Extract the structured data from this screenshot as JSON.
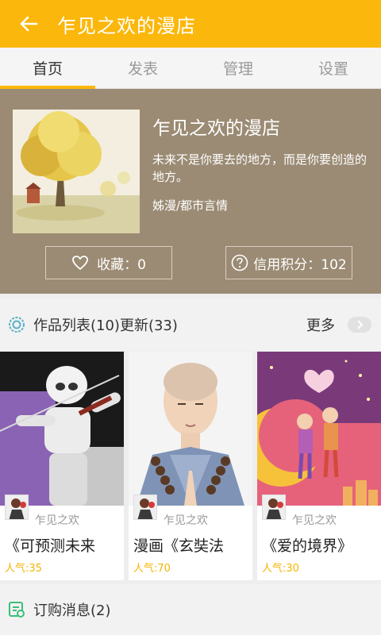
{
  "appbar": {
    "title": "乍见之欢的漫店"
  },
  "tabs": [
    {
      "label": "首页",
      "active": true
    },
    {
      "label": "发表",
      "active": false
    },
    {
      "label": "管理",
      "active": false
    },
    {
      "label": "设置",
      "active": false
    }
  ],
  "shop": {
    "name": "乍见之欢的漫店",
    "description": "未来不是你要去的地方，而是你要创造的地方。",
    "category": "姊漫/都市言情",
    "favorite_label": "收藏：0",
    "credit_label": "信用积分：102"
  },
  "works": {
    "header": "作品列表(10)更新(33)",
    "more_label": "更多",
    "items": [
      {
        "author": "乍见之欢",
        "title": "《可预测未来",
        "popularity": "人气:35"
      },
      {
        "author": "乍见之欢",
        "title": "漫画《玄奘法",
        "popularity": "人气:70"
      },
      {
        "author": "乍见之欢",
        "title": "《爱的境界》",
        "popularity": "人气:30"
      }
    ]
  },
  "orders": {
    "header": "订购消息(2)"
  },
  "colors": {
    "accent": "#fbb70b",
    "hero_bg": "#9b8b74",
    "popularity": "#f5b300"
  }
}
